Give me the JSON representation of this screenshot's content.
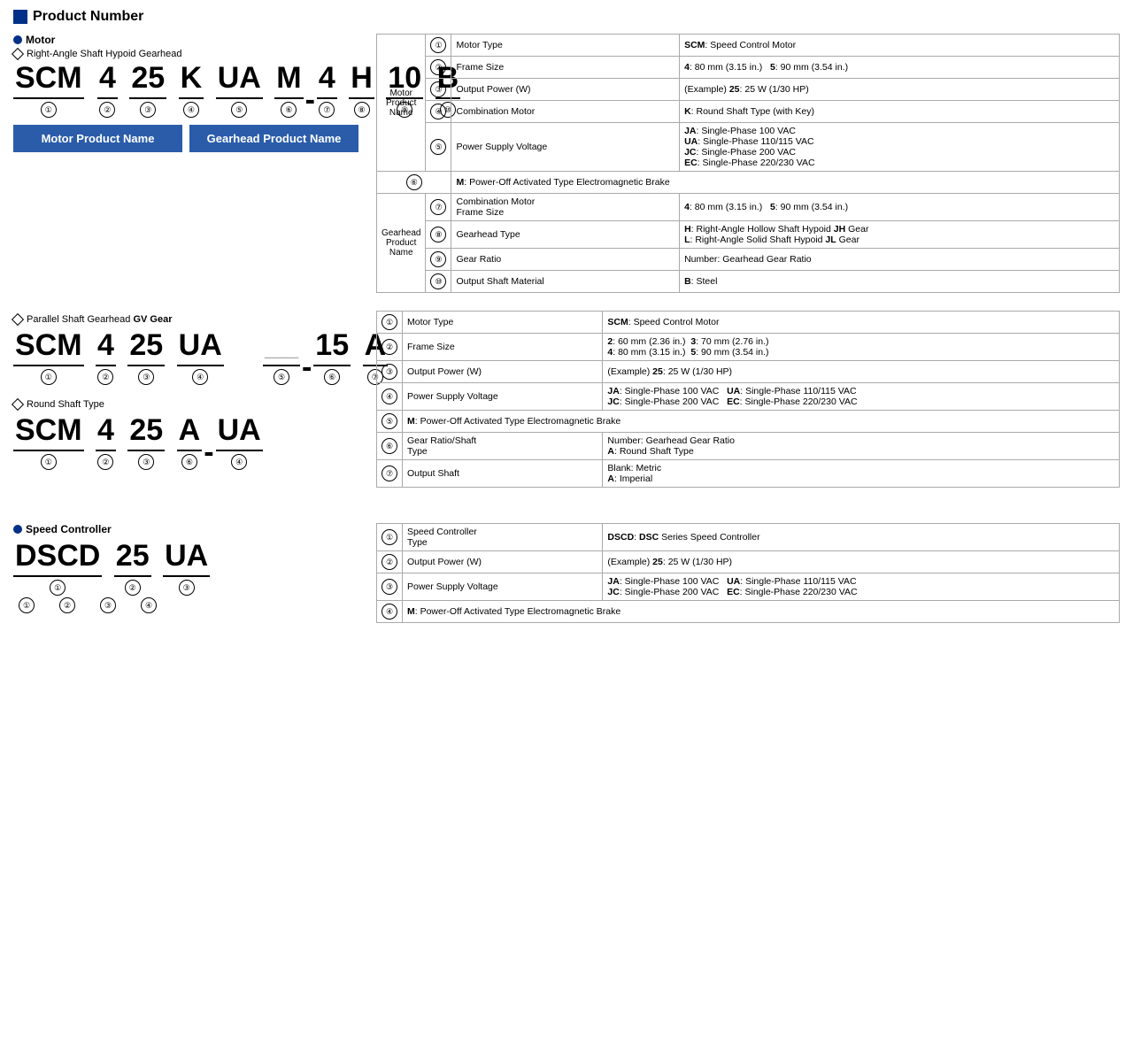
{
  "page": {
    "section_title": "Product Number",
    "motor_label": "Motor",
    "hypoid_label": "Right-Angle Shaft Hypoid Gearhead",
    "hypoid_code": [
      "SCM",
      "4",
      "25",
      "K",
      "UA",
      "M",
      "-",
      "4",
      "H",
      "10",
      "B"
    ],
    "hypoid_circles": [
      "①",
      "②",
      "③",
      "④",
      "⑤",
      "⑥",
      "⑦",
      "⑧",
      "⑨",
      "⑩"
    ],
    "motor_product_name": "Motor Product Name",
    "gearhead_product_name": "Gearhead Product Name",
    "hypoid_table": [
      {
        "num": "①",
        "group": "Motor\nProduct\nName",
        "show_group": true,
        "group_rows": 5,
        "label": "Motor Type",
        "value": "<b>SCM</b>: Speed Control Motor"
      },
      {
        "num": "②",
        "show_group": false,
        "label": "Frame Size",
        "value": "<b>4</b>: 80 mm (3.15 in.)&nbsp;&nbsp;&nbsp;<b>5</b>: 90 mm (3.54 in.)"
      },
      {
        "num": "③",
        "show_group": false,
        "label": "Output Power (W)",
        "value": "(Example) <b>25</b>: 25 W (1/30 HP)"
      },
      {
        "num": "④",
        "show_group": false,
        "label": "Combination Motor",
        "value": "<b>K</b>: Round Shaft Type (with Key)"
      },
      {
        "num": "⑤",
        "show_group": false,
        "label": "Power Supply Voltage",
        "value": "<b>JA</b>: Single-Phase 100 VAC<br><b>UA</b>: Single-Phase 110/115 VAC<br><b>JC</b>: Single-Phase 200 VAC<br><b>EC</b>: Single-Phase 220/230 VAC"
      },
      {
        "num": "⑥",
        "show_group": false,
        "label": "",
        "value": "<b>M</b>: Power-Off Activated Type Electromagnetic Brake",
        "colspan": true
      },
      {
        "num": "⑦",
        "group": "Gearhead\nProduct\nName",
        "show_group": true,
        "group_rows": 4,
        "label": "Combination Motor\nFrame Size",
        "value": "<b>4</b>: 80 mm (3.15 in.)&nbsp;&nbsp;&nbsp;<b>5</b>: 90 mm (3.54 in.)"
      },
      {
        "num": "⑧",
        "show_group": false,
        "label": "Gearhead Type",
        "value": "<b>H</b>: Right-Angle Hollow Shaft Hypoid <b>JH</b> Gear<br><b>L</b>: Right-Angle Solid Shaft Hypoid <b>JL</b> Gear"
      },
      {
        "num": "⑨",
        "show_group": false,
        "label": "Gear Ratio",
        "value": "Number: Gearhead Gear Ratio"
      },
      {
        "num": "⑩",
        "show_group": false,
        "label": "Output Shaft Material",
        "value": "<b>B</b>: Steel"
      }
    ],
    "parallel_label": "Parallel Shaft Gearhead GV Gear",
    "parallel_bold": "GV Gear",
    "parallel_code": [
      "SCM",
      "4",
      "25",
      "UA",
      "-",
      "15",
      "A"
    ],
    "parallel_circles": [
      "①",
      "②",
      "③",
      "④",
      "⑤",
      "⑥",
      "⑦"
    ],
    "parallel_table": [
      {
        "num": "①",
        "label": "Motor Type",
        "value": "<b>SCM</b>: Speed Control Motor"
      },
      {
        "num": "②",
        "label": "Frame Size",
        "value": "<b>2</b>: 60 mm (2.36 in.)&nbsp;&nbsp;<b>3</b>: 70 mm (2.76 in.)<br><b>4</b>: 80 mm (3.15 in.)&nbsp;&nbsp;<b>5</b>: 90 mm (3.54 in.)"
      },
      {
        "num": "③",
        "label": "Output Power (W)",
        "value": "(Example) <b>25</b>: 25 W (1/30 HP)"
      },
      {
        "num": "④",
        "label": "Power Supply Voltage",
        "value": "<b>JA</b>: Single-Phase 100 VAC&nbsp;&nbsp;&nbsp;<b>UA</b>: Single-Phase 110/115 VAC<br><b>JC</b>: Single-Phase 200 VAC&nbsp;&nbsp;&nbsp;<b>EC</b>: Single-Phase 220/230 VAC"
      },
      {
        "num": "⑤",
        "label": "",
        "value": "<b>M</b>: Power-Off Activated Type Electromagnetic Brake",
        "colspan": true
      },
      {
        "num": "⑥",
        "label": "Gear Ratio/Shaft\nType",
        "value": "Number: Gearhead Gear Ratio<br><b>A</b>: Round Shaft Type"
      },
      {
        "num": "⑦",
        "label": "Output Shaft",
        "value": "Blank: Metric<br><b>A</b>: Imperial"
      }
    ],
    "round_label": "Round Shaft Type",
    "round_code": [
      "SCM",
      "4",
      "25",
      "A",
      "-",
      "UA"
    ],
    "round_circles_order": [
      "①",
      "②",
      "③",
      "⑥",
      "④"
    ],
    "speed_controller_label": "Speed Controller",
    "speed_code": [
      "DSCD",
      "25",
      "UA"
    ],
    "speed_circles": [
      "①",
      "②",
      "③",
      "④"
    ],
    "speed_table": [
      {
        "num": "①",
        "label": "Speed Controller\nType",
        "value": "<b>DSCD</b>: <b>DSC</b> Series Speed Controller"
      },
      {
        "num": "②",
        "label": "Output Power (W)",
        "value": "(Example) <b>25</b>: 25 W (1/30 HP)"
      },
      {
        "num": "③",
        "label": "Power Supply Voltage",
        "value": "<b>JA</b>: Single-Phase 100 VAC&nbsp;&nbsp;&nbsp;<b>UA</b>: Single-Phase 110/115 VAC<br><b>JC</b>: Single-Phase 200 VAC&nbsp;&nbsp;&nbsp;<b>EC</b>: Single-Phase 220/230 VAC"
      },
      {
        "num": "④",
        "label": "",
        "value": "<b>M</b>: Power-Off Activated Type Electromagnetic Brake",
        "colspan": true
      }
    ]
  }
}
